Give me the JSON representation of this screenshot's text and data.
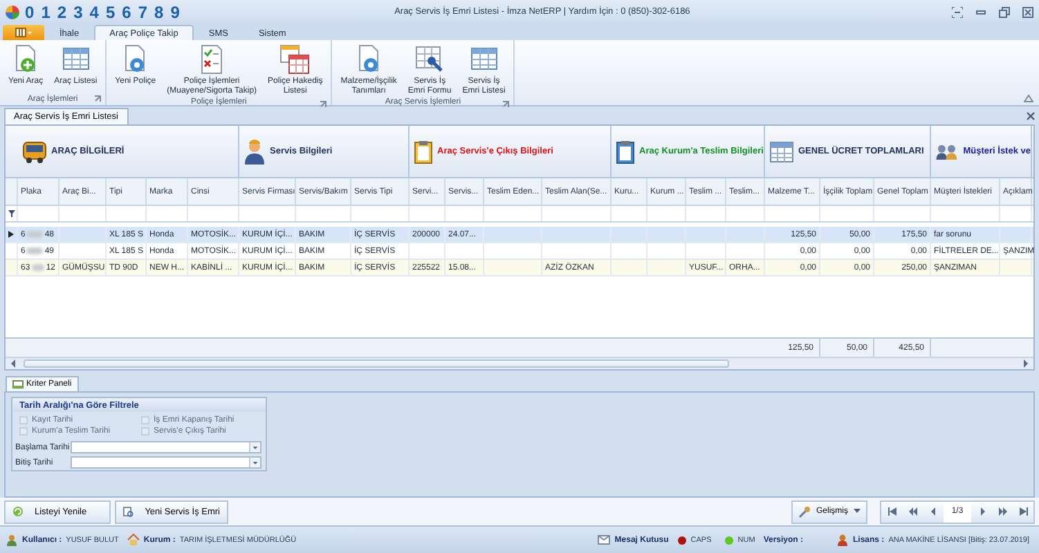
{
  "window": {
    "title": "Araç Servis İş Emri Listesi - İmza NetERP | Yardım İçin : 0 (850)-302-6186"
  },
  "quick_access": [
    "0",
    "1",
    "2",
    "3",
    "4",
    "5",
    "6",
    "7",
    "8",
    "9"
  ],
  "ribbon": {
    "tabs": [
      {
        "label": "İhale",
        "selected": false
      },
      {
        "label": "Araç Poliçe Takip",
        "selected": true
      },
      {
        "label": "SMS",
        "selected": false
      },
      {
        "label": "Sistem",
        "selected": false
      }
    ],
    "groups": [
      {
        "title": "Araç İşlemleri",
        "buttons": [
          {
            "label": "Yeni Araç",
            "kind": "adddoc"
          },
          {
            "label": "Araç Listesi",
            "kind": "table"
          }
        ]
      },
      {
        "title": "Poliçe İşlemleri",
        "buttons": [
          {
            "label": "Yeni Poliçe",
            "kind": "bluedoc"
          },
          {
            "label": "Poliçe İşlemleri\n(Muayene/Sigorta Takip)",
            "kind": "checklist"
          },
          {
            "label": "Poliçe Hakediş\nListesi",
            "kind": "calendar"
          }
        ]
      },
      {
        "title": "Araç Servis İşlemleri",
        "buttons": [
          {
            "label": "Malzeme/İşçilik\nTanımları",
            "kind": "bluedoc"
          },
          {
            "label": "Servis İş\nEmri Formu",
            "kind": "wrench"
          },
          {
            "label": "Servis İş\nEmri Listesi",
            "kind": "table"
          }
        ]
      }
    ]
  },
  "document_tabs": [
    {
      "label": "Araç Servis İş Emri Listesi",
      "selected": true
    }
  ],
  "grid": {
    "bands": [
      {
        "title": "ARAÇ BİLGİLERİ",
        "kind": "vehicle",
        "color": "#1f2d5c"
      },
      {
        "title": "Servis Bilgileri",
        "kind": "mechanic",
        "color": "#1f2d5c"
      },
      {
        "title": "Araç Servis'e Çıkış Bilgileri",
        "kind": "exit",
        "color": "#e01010"
      },
      {
        "title": "Araç Kurum'a Teslim Bilgileri",
        "kind": "delivery",
        "color": "#109020"
      },
      {
        "title": "GENEL ÜCRET TOPLAMLARI",
        "kind": "totals",
        "color": "#1f2d5c"
      },
      {
        "title": "Müşteri İstek ve",
        "kind": "customer",
        "color": "#1a1a9c"
      }
    ],
    "columns": [
      "Plaka",
      "Araç Bi...",
      "Tipi",
      "Marka",
      "Cinsi",
      "Servis Firması",
      "Servis/Bakım",
      "Servis Tipi",
      "Servi...",
      "Servis...",
      "Teslim Eden...",
      "Teslim Alan(Se...",
      "Kuru...",
      "Kurum ...",
      "Teslim ...",
      "Teslim...",
      "Malzeme T...",
      "İşçilik Toplam",
      "Genel Toplam",
      "Müşteri İstekleri",
      "Açıklam"
    ],
    "rows": [
      {
        "selected": true,
        "highlighted": false,
        "cells": [
          {
            "start": "6",
            "end": "48"
          },
          "",
          "XL 185 S",
          "Honda",
          "MOTOSİK...",
          "KURUM İÇİ...",
          "BAKIM",
          "İÇ SERVİS",
          "200000",
          "24.07...",
          "",
          "",
          "",
          "",
          "",
          "",
          "125,50",
          "50,00",
          "175,50",
          "far sorunu",
          ""
        ]
      },
      {
        "selected": false,
        "highlighted": false,
        "cells": [
          {
            "start": "6",
            "end": "49"
          },
          "",
          "XL 185 S",
          "Honda",
          "MOTOSİK...",
          "KURUM İÇİ...",
          "BAKIM",
          "İÇ SERVİS",
          "",
          "",
          "",
          "",
          "",
          "",
          "",
          "",
          "0,00",
          "0,00",
          "0,00",
          "FİLTRELER DE...",
          "ŞANZIM"
        ]
      },
      {
        "selected": false,
        "highlighted": true,
        "cells": [
          {
            "start": "63",
            "end": "12"
          },
          "GÜMÜŞSU",
          "TD 90D",
          "NEW H...",
          "KABİNLİ ...",
          "KURUM İÇİ...",
          "BAKIM",
          "İÇ SERVİS",
          "225522",
          "15.08...",
          "",
          "AZİZ ÖZKAN",
          "",
          "",
          "YUSUF...",
          "ORHA...",
          "0,00",
          "0,00",
          "250,00",
          "ŞANZIMAN",
          ""
        ]
      }
    ],
    "summary": [
      "125,50",
      "50,00",
      "425,50"
    ]
  },
  "criteria_panel": {
    "tab": "Kriter Paneli",
    "group_title": "Tarih Aralığı'na Göre Filtrele",
    "checkboxes": [
      {
        "label": "Kayıt Tarihi",
        "checked": false
      },
      {
        "label": "İş Emri Kapanış Tarihi",
        "checked": false
      },
      {
        "label": "Kurum'a Teslim Tarihi",
        "checked": false
      },
      {
        "label": "Servis'e Çıkış Tarihi",
        "checked": false
      }
    ],
    "date_fields": [
      {
        "label": "Başlama Tarihi"
      },
      {
        "label": "Bitiş Tarihi"
      }
    ]
  },
  "actions": [
    {
      "label": "Listeyi Yenile",
      "kind": "refresh"
    },
    {
      "label": "Yeni Servis İş Emri",
      "kind": "form"
    }
  ],
  "advanced_button": "Gelişmiş",
  "pager": {
    "page": "1/3"
  },
  "status_bar": {
    "user_label": "Kullanıcı :",
    "user": "YUSUF BULUT",
    "org_label": "Kurum :",
    "org": "TARIM İŞLETMESİ MÜDÜRLÜĞÜ",
    "messages": "Mesaj Kutusu",
    "indicators": [
      {
        "label": "CAPS",
        "on": false
      },
      {
        "label": "NUM",
        "on": true
      }
    ],
    "version_label": "Versiyon :",
    "license_label": "Lisans :",
    "license": "ANA MAKİNE LİSANSI [Bitiş: 23.07.2019]"
  }
}
